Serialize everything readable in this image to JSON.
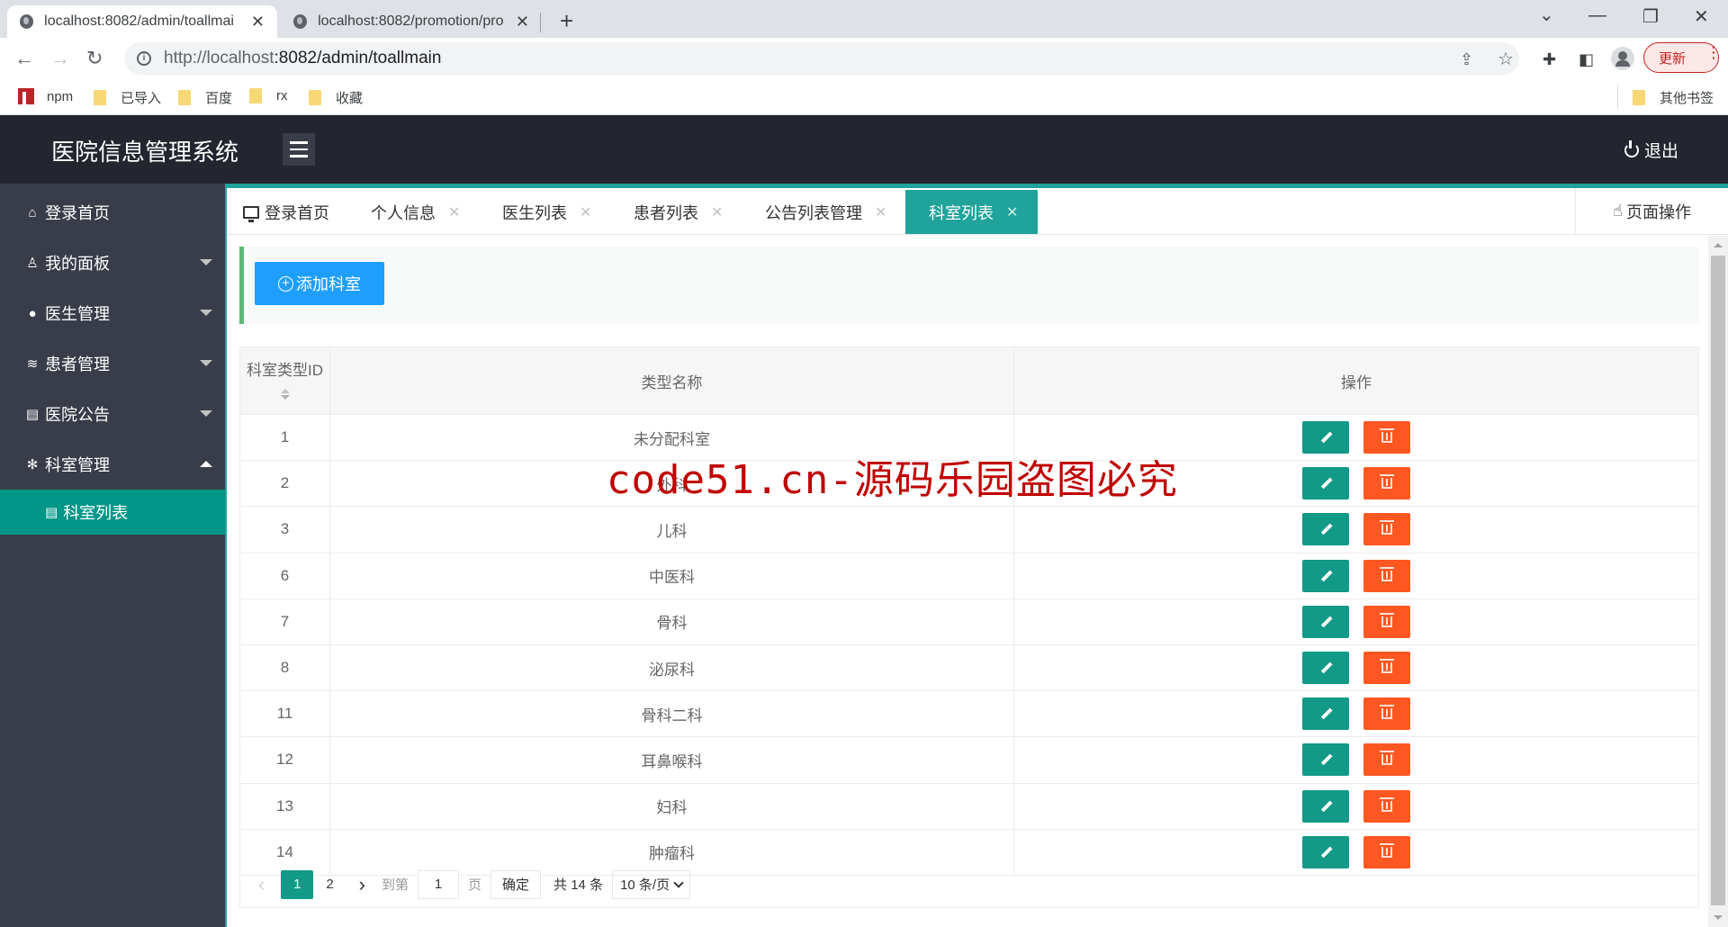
{
  "browser": {
    "tabs": [
      {
        "title": "localhost:8082/admin/toallmai",
        "active": true
      },
      {
        "title": "localhost:8082/promotion/pro",
        "active": false
      }
    ],
    "new_tab": "+",
    "close_glyph": "✕",
    "url_host": "http://localhost",
    "url_rest": ":8082/admin/toallmain",
    "update_label": "更新",
    "bookmarks": [
      "npm",
      "已导入",
      "百度",
      "rx",
      "收藏"
    ],
    "other_bookmarks": "其他书签"
  },
  "app": {
    "title": "医院信息管理系统",
    "logout_label": "退出"
  },
  "sidebar": {
    "items": [
      {
        "label": "登录首页",
        "icon": "home-icon",
        "glyph": "⌂",
        "caret": "none"
      },
      {
        "label": "我的面板",
        "icon": "user-icon",
        "glyph": "♙",
        "caret": "down"
      },
      {
        "label": "医生管理",
        "icon": "chat-icon",
        "glyph": "●",
        "caret": "down"
      },
      {
        "label": "患者管理",
        "icon": "layers-icon",
        "glyph": "≋",
        "caret": "down"
      },
      {
        "label": "医院公告",
        "icon": "note-icon",
        "glyph": "▤",
        "caret": "down"
      },
      {
        "label": "科室管理",
        "icon": "snowflake-icon",
        "glyph": "✻",
        "caret": "up"
      }
    ],
    "sub_items": [
      {
        "label": "科室列表",
        "icon": "note-icon",
        "glyph": "▤",
        "active": true
      }
    ]
  },
  "content_tabs": [
    {
      "label": "登录首页",
      "closable": false,
      "active": false
    },
    {
      "label": "个人信息",
      "closable": true,
      "active": false
    },
    {
      "label": "医生列表",
      "closable": true,
      "active": false
    },
    {
      "label": "患者列表",
      "closable": true,
      "active": false
    },
    {
      "label": "公告列表管理",
      "closable": true,
      "active": false
    },
    {
      "label": "科室列表",
      "closable": true,
      "active": true
    }
  ],
  "tab_close_glyph": "✕",
  "page_ops_label": "页面操作",
  "toolbar": {
    "add_label": "添加科室"
  },
  "table": {
    "columns": [
      "科室类型ID",
      "类型名称",
      "操作"
    ],
    "rows": [
      {
        "id": "1",
        "name": "未分配科室"
      },
      {
        "id": "2",
        "name": "外科"
      },
      {
        "id": "3",
        "name": "儿科"
      },
      {
        "id": "6",
        "name": "中医科"
      },
      {
        "id": "7",
        "name": "骨科"
      },
      {
        "id": "8",
        "name": "泌尿科"
      },
      {
        "id": "11",
        "name": "骨科二科"
      },
      {
        "id": "12",
        "name": "耳鼻喉科"
      },
      {
        "id": "13",
        "name": "妇科"
      },
      {
        "id": "14",
        "name": "肿瘤科"
      }
    ]
  },
  "pagination": {
    "prev": "‹",
    "next": "›",
    "pages": [
      "1",
      "2"
    ],
    "current": "1",
    "goto_label": "到第",
    "goto_value": "1",
    "page_unit": "页",
    "confirm_label": "确定",
    "total_label": "共 14 条",
    "page_size_label": "10 条/页"
  },
  "watermark": "code51.cn-源码乐园盗图必究",
  "colors": {
    "header_bg": "#23262e",
    "sidebar_bg": "#393d49",
    "accent_teal": "#009688",
    "tab_active": "#20a39b",
    "add_button": "#1e9fff",
    "edit_button": "#129987",
    "delete_button": "#ff5722",
    "watermark": "#c00000"
  }
}
